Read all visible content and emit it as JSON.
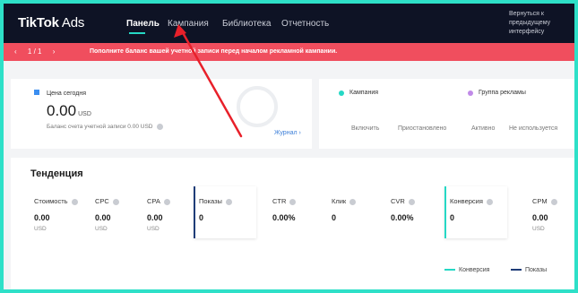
{
  "topbar": {
    "logo_main": "TikTok",
    "logo_sub": " Ads",
    "nav": [
      "Панель",
      "Кампания",
      "Библиотека",
      "Отчетность"
    ],
    "return_link": "Вернуться к предыдущему интерфейсу"
  },
  "alert": {
    "pager": "1 / 1",
    "message": "Пополните баланс вашей учетной записи перед началом рекламной кампании."
  },
  "balance_card": {
    "label": "Цена сегодня",
    "value": "0.00",
    "unit": "USD",
    "balance_text": "Баланс счета учетной записи 0.00 USD",
    "journal_link": "Журнал"
  },
  "status_card": {
    "campaign_label": "Кампания",
    "adgroup_label": "Группа рекламы",
    "campaign_stats": [
      "Включить",
      "Приостановлено"
    ],
    "adgroup_stats": [
      "Активно",
      "Не используется"
    ]
  },
  "trend": {
    "title": "Тенденция",
    "metrics": [
      {
        "name": "Стоимость",
        "value": "0.00",
        "unit": "USD"
      },
      {
        "name": "CPC",
        "value": "0.00",
        "unit": "USD"
      },
      {
        "name": "CPA",
        "value": "0.00",
        "unit": "USD"
      },
      {
        "name": "Показы",
        "value": "0",
        "unit": ""
      },
      {
        "name": "CTR",
        "value": "0.00%",
        "unit": ""
      },
      {
        "name": "Клик",
        "value": "0",
        "unit": ""
      },
      {
        "name": "CVR",
        "value": "0.00%",
        "unit": ""
      },
      {
        "name": "Конверсия",
        "value": "0",
        "unit": ""
      },
      {
        "name": "CPM",
        "value": "0.00",
        "unit": "USD"
      }
    ],
    "legend": [
      "Конверсия",
      "Показы"
    ]
  },
  "colors": {
    "accent": "#25d8c5",
    "navy": "#1f3d78",
    "alert": "#f04e5e",
    "arrow": "#e8202a"
  }
}
